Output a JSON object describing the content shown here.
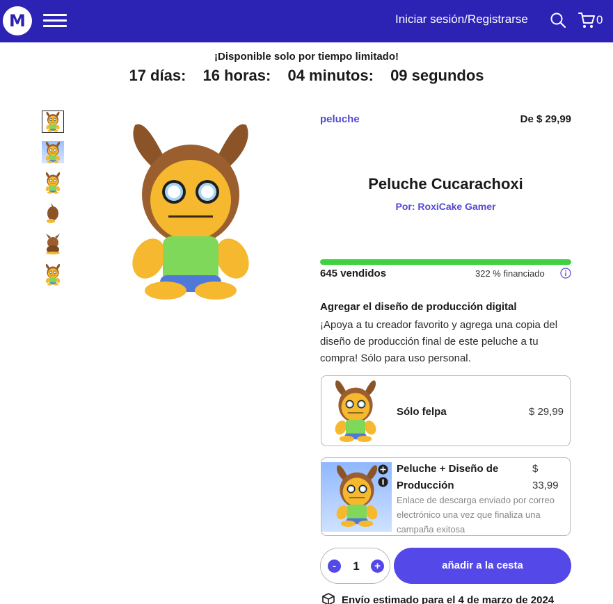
{
  "header": {
    "logo_letter": "M",
    "login_label": "Iniciar sesión/Registrarse",
    "cart_count": "0",
    "brand_color": "#2c22b4"
  },
  "promo": {
    "limited_text": "¡Disponible solo por tiempo limitado!",
    "days": "17 días:",
    "hours": "16 horas:",
    "minutes": "04 minutos:",
    "seconds": "09 segundos"
  },
  "gallery": {
    "thumbnail_count": 6,
    "selected_index": 0
  },
  "product": {
    "category": "peluche",
    "price_from": "De $ 29,99",
    "title": "Peluche Cucarachoxi",
    "byline": "Por: RoxiCake Gamer",
    "progress_fraction": 1.0,
    "sold": "645 vendidos",
    "funded": "322 % financiado"
  },
  "digital": {
    "title": "Agregar el diseño de producción digital",
    "description": "¡Apoya a tu creador favorito y agrega una copia del diseño de producción final de este peluche a tu compra! Sólo para uso personal."
  },
  "options": [
    {
      "name": "Sólo felpa",
      "price": "$ 29,99"
    },
    {
      "name": "Peluche + Diseño de Producción",
      "price": "$ 33,99",
      "note": "Enlace de descarga enviado por correo electrónico una vez que finaliza una campaña exitosa"
    }
  ],
  "purchase": {
    "minus": "-",
    "plus": "+",
    "quantity": "1",
    "add_label": "añadir a la cesta",
    "accent_color": "#5448e8"
  },
  "shipping": {
    "text": "Envío estimado para el 4 de marzo de 2024"
  }
}
